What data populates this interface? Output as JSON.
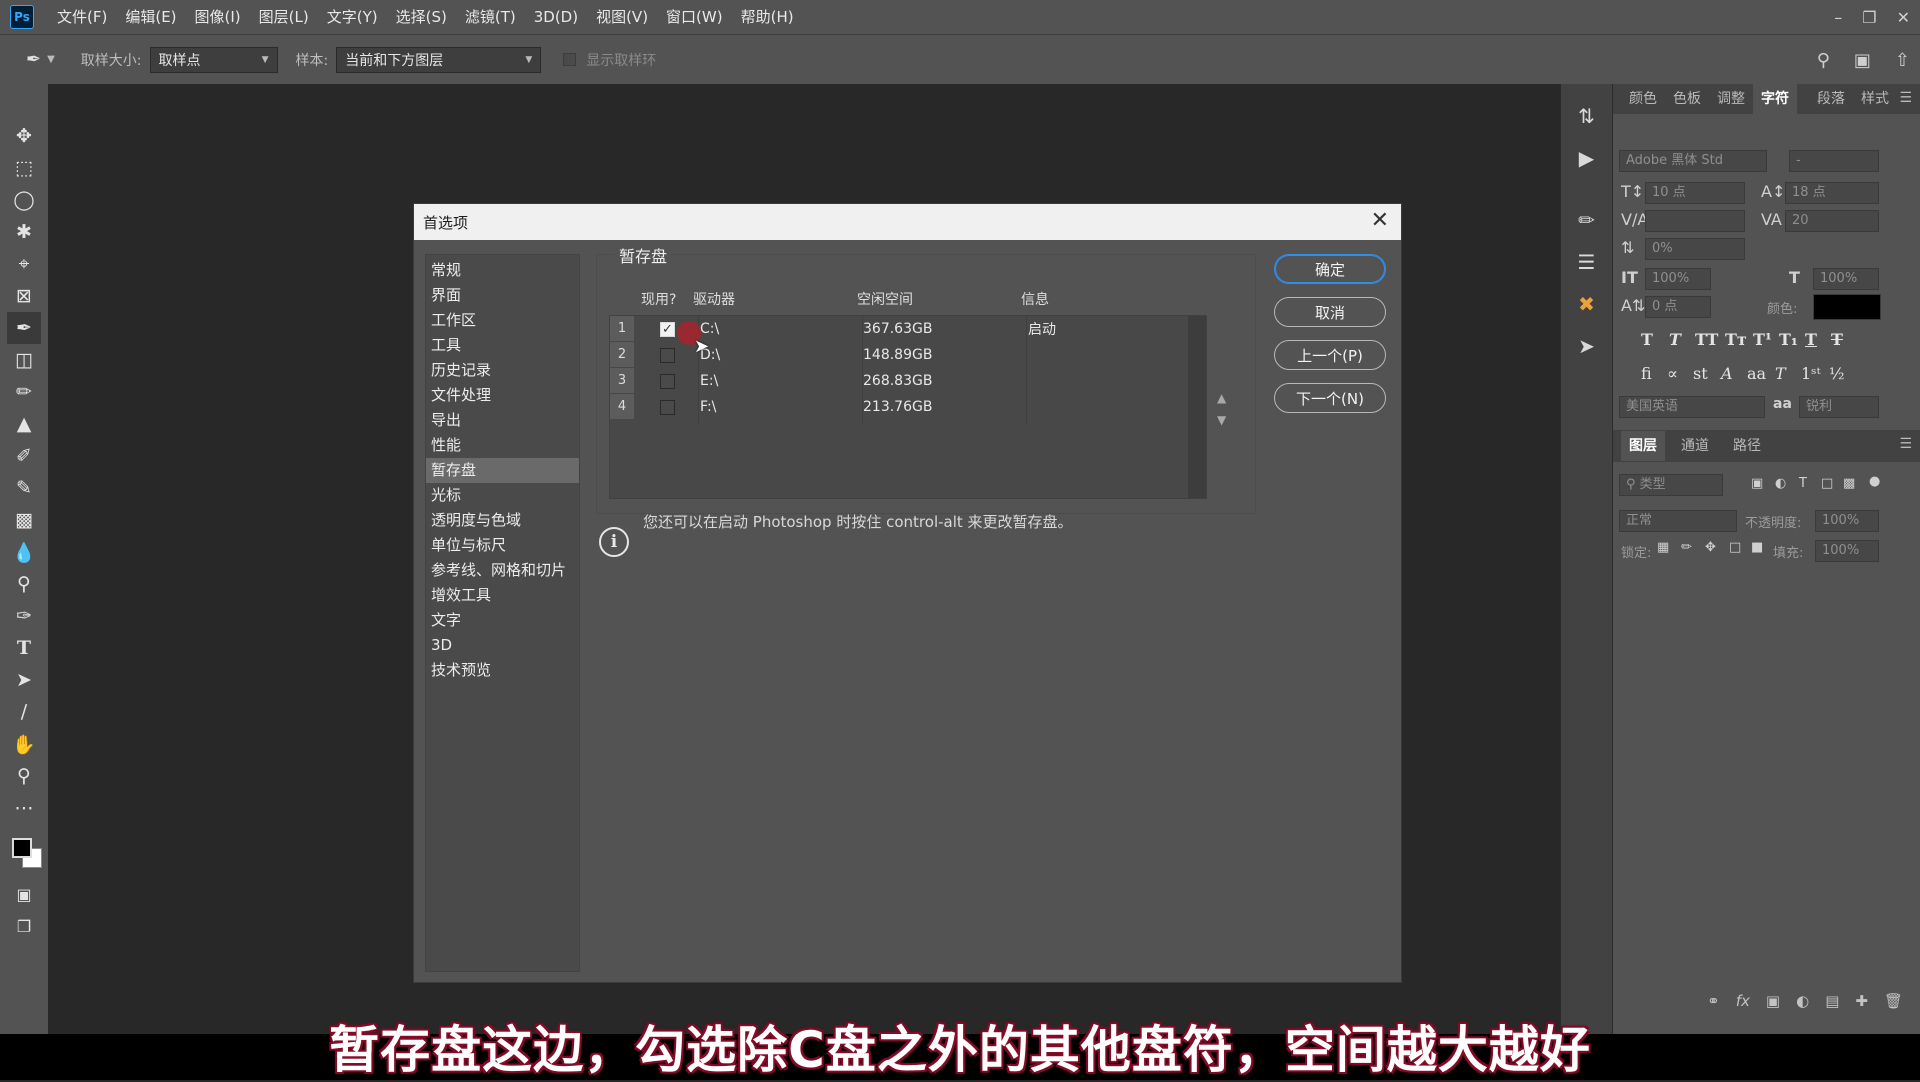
{
  "app": {
    "logo": "Ps"
  },
  "menu": [
    "文件(F)",
    "编辑(E)",
    "图像(I)",
    "图层(L)",
    "文字(Y)",
    "选择(S)",
    "滤镜(T)",
    "3D(D)",
    "视图(V)",
    "窗口(W)",
    "帮助(H)"
  ],
  "options": {
    "sample_size_label": "取样大小:",
    "sample_size_value": "取样点",
    "sample_label": "样本:",
    "sample_value": "当前和下方图层",
    "show_ring_label": "显示取样环"
  },
  "right_panel": {
    "tabs_top": [
      "颜色",
      "色板",
      "调整",
      "字符",
      "段落",
      "样式"
    ],
    "active_top": "字符",
    "font_family": "Adobe 黑体 Std",
    "font_style": "-",
    "font_size": "10 点",
    "leading": "18 点",
    "tracking": "20",
    "scale_pct": "0%",
    "vscale": "100%",
    "hscale": "100%",
    "baseline": "0 点",
    "color_label": "颜色:",
    "language": "美国英语",
    "aa_label": "aa",
    "antialias": "锐利",
    "tabs_bottom": [
      "图层",
      "通道",
      "路径"
    ],
    "active_bottom": "图层",
    "filter_kind": "类型",
    "blend_mode": "正常",
    "opacity_label": "不透明度:",
    "opacity": "100%",
    "lock_label": "锁定:",
    "fill_label": "填充:",
    "fill": "100%"
  },
  "dialog": {
    "title": "首选项",
    "nav": [
      "常规",
      "界面",
      "工作区",
      "工具",
      "历史记录",
      "文件处理",
      "导出",
      "性能",
      "暂存盘",
      "光标",
      "透明度与色域",
      "单位与标尺",
      "参考线、网格和切片",
      "增效工具",
      "文字",
      "3D",
      "技术预览"
    ],
    "active_nav_index": 8,
    "group_title": "暂存盘",
    "headers": {
      "active": "现用?",
      "drive": "驱动器",
      "free": "空闲空间",
      "info": "信息"
    },
    "rows": [
      {
        "num": "1",
        "checked": true,
        "drive": "C:\\",
        "free": "367.63GB",
        "info": "启动"
      },
      {
        "num": "2",
        "checked": false,
        "drive": "D:\\",
        "free": "148.89GB",
        "info": ""
      },
      {
        "num": "3",
        "checked": false,
        "drive": "E:\\",
        "free": "268.83GB",
        "info": ""
      },
      {
        "num": "4",
        "checked": false,
        "drive": "F:\\",
        "free": "213.76GB",
        "info": ""
      }
    ],
    "buttons": {
      "ok": "确定",
      "cancel": "取消",
      "prev": "上一个(P)",
      "next": "下一个(N)"
    },
    "info_text": "您还可以在启动 Photoshop 时按住 control-alt 来更改暂存盘。"
  },
  "subtitle": "暂存盘这边，勾选除C盘之外的其他盘符，空间越大越好"
}
